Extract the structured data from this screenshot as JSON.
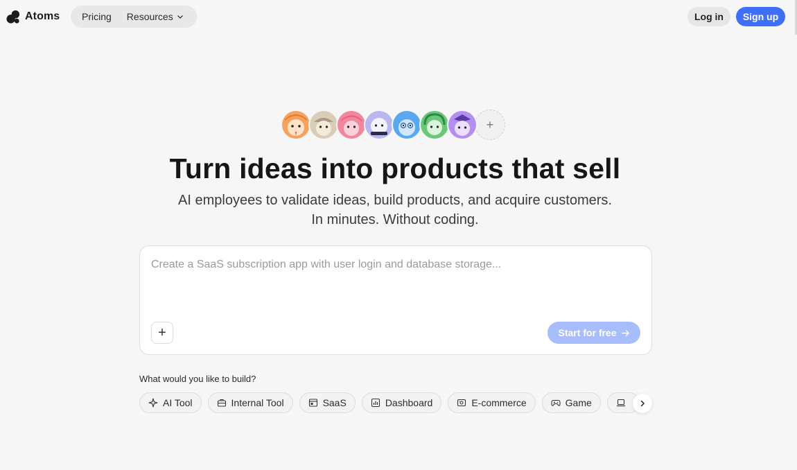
{
  "header": {
    "logo_text": "Atoms",
    "nav": [
      {
        "label": "Pricing"
      },
      {
        "label": "Resources"
      }
    ],
    "login_label": "Log in",
    "signup_label": "Sign up"
  },
  "avatars": [
    {
      "name": "orange-agent-avatar",
      "color": "#f4a261"
    },
    {
      "name": "beige-agent-avatar",
      "color": "#cfc3b0"
    },
    {
      "name": "pink-agent-avatar",
      "color": "#f2869f"
    },
    {
      "name": "lavender-agent-avatar",
      "color": "#b9b7f0"
    },
    {
      "name": "blue-agent-avatar",
      "color": "#5aa8f0"
    },
    {
      "name": "green-agent-avatar",
      "color": "#7fd08a"
    },
    {
      "name": "purple-agent-avatar",
      "color": "#b48ff0"
    }
  ],
  "avatar_add_symbol": "+",
  "hero": {
    "title": "Turn ideas into products that sell",
    "subtitle_line1": "AI employees to validate ideas, build products, and acquire customers.",
    "subtitle_line2": "In minutes. Without coding."
  },
  "prompt": {
    "placeholder": "Create a SaaS subscription app with user login and database storage...",
    "value": "",
    "attach_symbol": "+",
    "start_label": "Start for free"
  },
  "build": {
    "question": "What would you like to build?",
    "chips": [
      {
        "label": "AI Tool",
        "icon": "sparkle-icon"
      },
      {
        "label": "Internal Tool",
        "icon": "toolbox-icon"
      },
      {
        "label": "SaaS",
        "icon": "browser-window-icon"
      },
      {
        "label": "Dashboard",
        "icon": "bar-chart-icon"
      },
      {
        "label": "E-commerce",
        "icon": "storefront-icon"
      },
      {
        "label": "Game",
        "icon": "gamepad-icon"
      },
      {
        "label": "",
        "icon": "laptop-icon"
      }
    ]
  },
  "colors": {
    "accent": "#3f6ff6",
    "accent_disabled": "#a8bdfb",
    "background": "#f6f6f6"
  }
}
